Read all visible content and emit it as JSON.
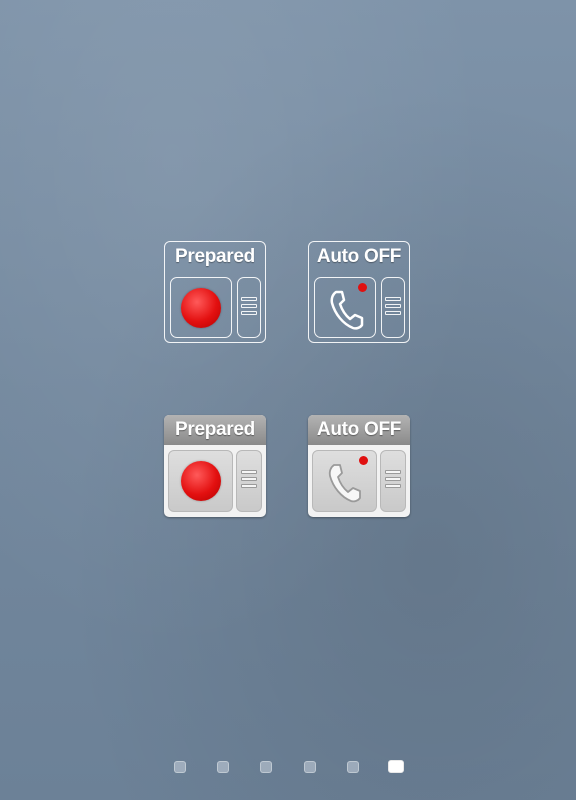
{
  "widgets": [
    {
      "style": "outline",
      "title": "Prepared",
      "icon": "record-dot-icon"
    },
    {
      "style": "outline",
      "title": "Auto OFF",
      "icon": "phone-icon"
    },
    {
      "style": "solid",
      "title": "Prepared",
      "icon": "record-dot-icon"
    },
    {
      "style": "solid",
      "title": "Auto OFF",
      "icon": "phone-icon"
    }
  ],
  "colors": {
    "record_red": "#e31010",
    "notify_red": "#e01010",
    "wallpaper": "#7a8fa5"
  },
  "page_indicator": {
    "count": 6,
    "active_index": 5
  }
}
